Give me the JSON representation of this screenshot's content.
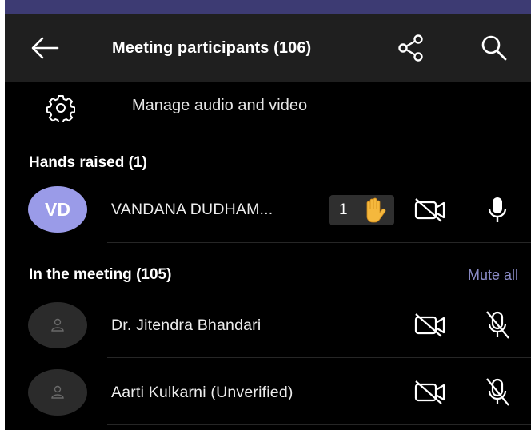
{
  "header": {
    "title": "Meeting participants (106)",
    "back_icon": "arrow-left-icon",
    "share_icon": "share-icon",
    "search_icon": "search-icon"
  },
  "manage": {
    "label": "Manage audio and video",
    "icon": "gear-icon"
  },
  "hands_raised": {
    "title": "Hands raised (1)",
    "participants": [
      {
        "initials": "VD",
        "name": "VANDANA DUDHAM...",
        "raise_count": "1",
        "camera": "off",
        "mic": "on"
      }
    ]
  },
  "in_meeting": {
    "title": "In the meeting (105)",
    "mute_all_label": "Mute all",
    "participants": [
      {
        "name": "Dr. Jitendra Bhandari",
        "camera": "off",
        "mic": "muted"
      },
      {
        "name": "Aarti Kulkarni (Unverified)",
        "camera": "off",
        "mic": "muted"
      }
    ]
  },
  "colors": {
    "header_bg": "#1f1f1f",
    "top_strip": "#3d3b73",
    "accent": "#8b8cc7",
    "avatar_vd": "#9a9be8",
    "avatar_gray": "#2b2b2b",
    "raised_chip": "#2f2f2f",
    "hand": "#f5b83d"
  }
}
